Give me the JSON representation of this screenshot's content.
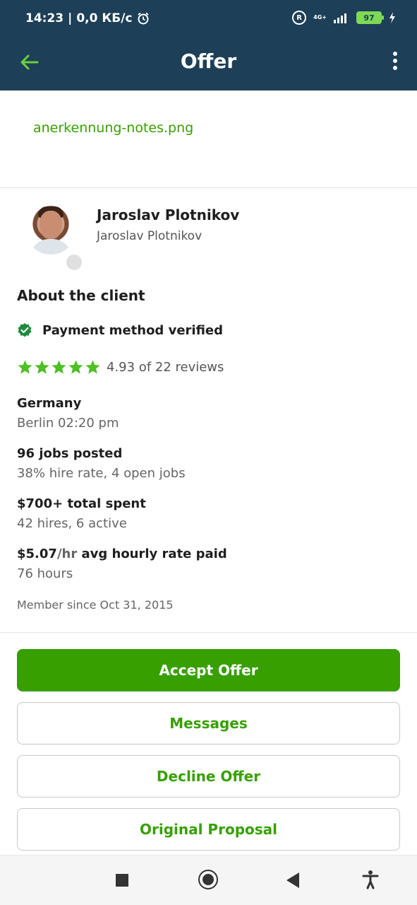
{
  "status_bar": {
    "time": "14:23",
    "speed": "0,0 КБ/с",
    "network_label": "4G+",
    "battery": "97"
  },
  "app_bar": {
    "title": "Offer"
  },
  "attachment": {
    "filename": "anerkennung-notes.png"
  },
  "client": {
    "name": "Jaroslav Plotnikov",
    "subtitle": "Jaroslav Plotnikov",
    "section_title": "About the client",
    "payment_verified": "Payment method verified",
    "rating_value": 4.93,
    "rating_stars": 5,
    "rating_text": "4.93 of 22 reviews",
    "country": "Germany",
    "local_time": "Berlin 02:20 pm",
    "jobs_posted": "96 jobs posted",
    "hire_info": "38% hire rate, 4 open jobs",
    "total_spent": "$700+ total spent",
    "hires_info": "42 hires, 6 active",
    "rate_amount": "$5.07",
    "rate_unit": "/hr",
    "rate_suffix": " avg hourly rate paid",
    "hours": "76 hours",
    "member_since": "Member since Oct 31, 2015"
  },
  "actions": {
    "accept": "Accept Offer",
    "messages": "Messages",
    "decline": "Decline Offer",
    "proposal": "Original Proposal"
  },
  "colors": {
    "header_bg": "#1d3f57",
    "accent_green": "#37a000",
    "back_arrow": "#6ccf3e"
  }
}
